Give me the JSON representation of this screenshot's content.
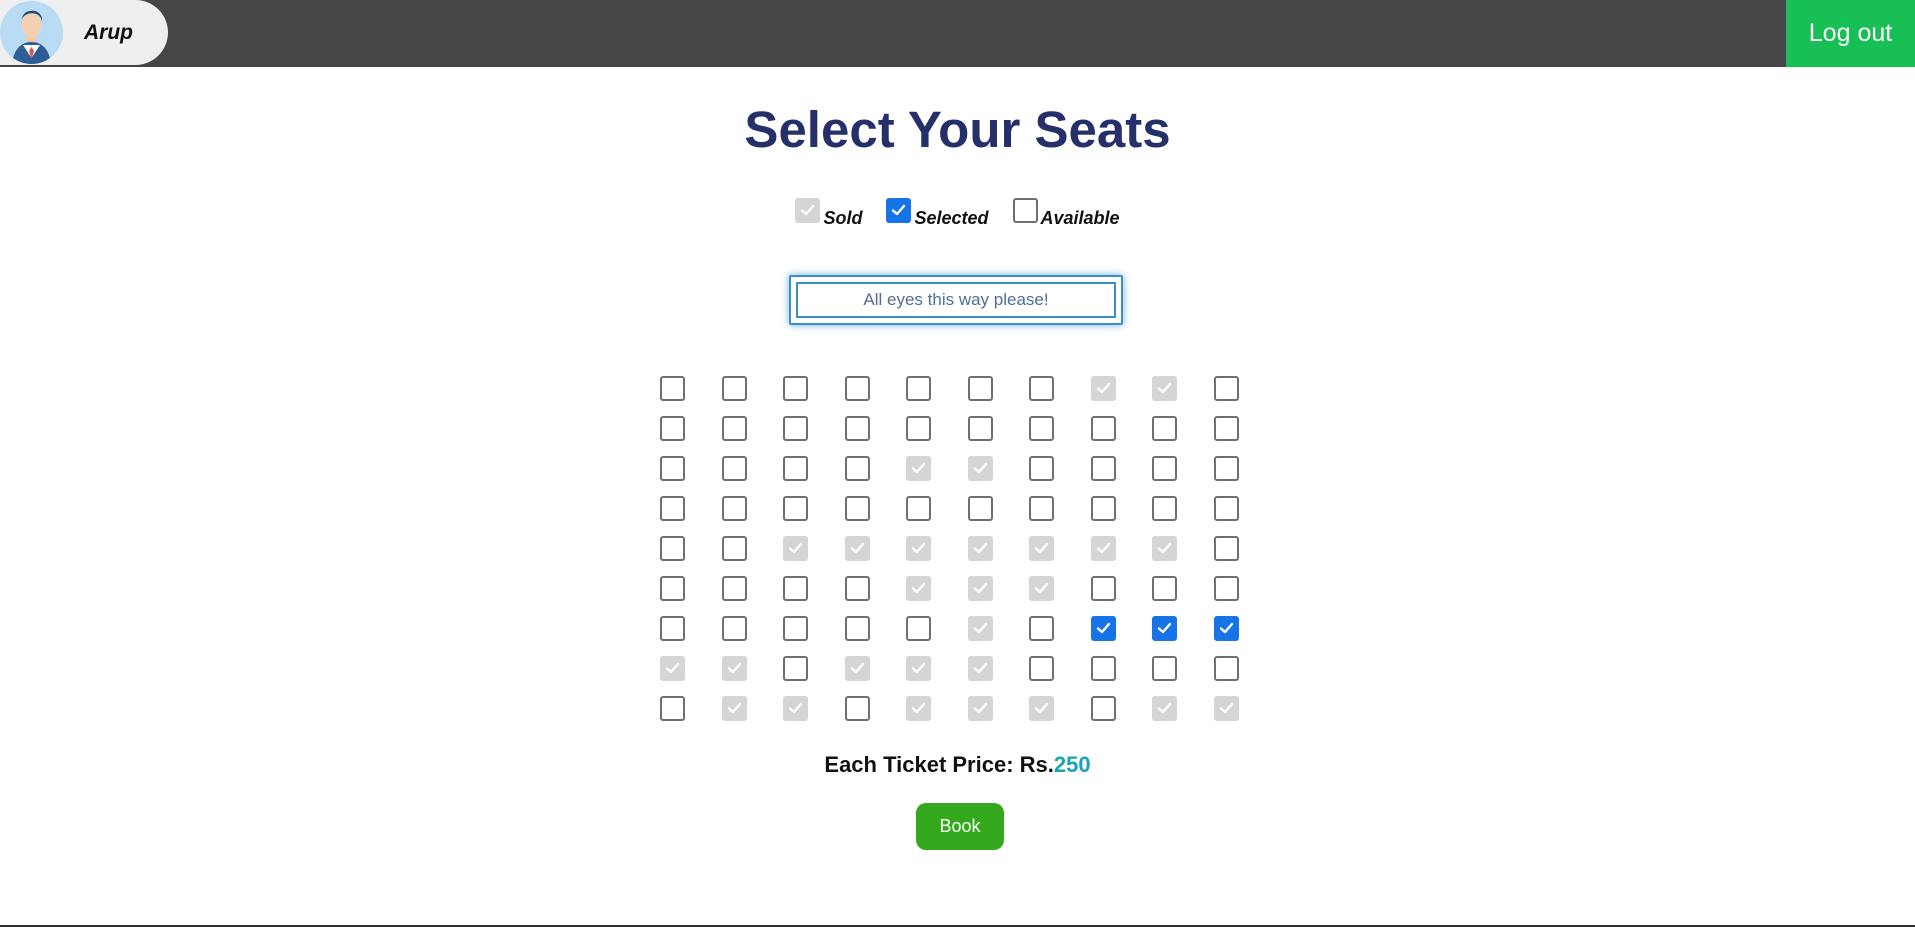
{
  "header": {
    "user_name": "Arup",
    "logout_label": "Log out",
    "avatar_icon": "user-avatar-icon"
  },
  "page": {
    "title": "Select Your Seats"
  },
  "legend": {
    "sold": "Sold",
    "selected": "Selected",
    "available": "Available"
  },
  "screen": {
    "label": "All eyes this way please!"
  },
  "price": {
    "label": "Each Ticket Price: Rs.",
    "value": "250"
  },
  "actions": {
    "book_label": "Book"
  },
  "seats": [
    [
      "available",
      "available",
      "available",
      "available",
      "available",
      "available",
      "available",
      "sold",
      "sold",
      "available"
    ],
    [
      "available",
      "available",
      "available",
      "available",
      "available",
      "available",
      "available",
      "available",
      "available",
      "available"
    ],
    [
      "available",
      "available",
      "available",
      "available",
      "sold",
      "sold",
      "available",
      "available",
      "available",
      "available"
    ],
    [
      "available",
      "available",
      "available",
      "available",
      "available",
      "available",
      "available",
      "available",
      "available",
      "available"
    ],
    [
      "available",
      "available",
      "sold",
      "sold",
      "sold",
      "sold",
      "sold",
      "sold",
      "sold",
      "available"
    ],
    [
      "available",
      "available",
      "available",
      "available",
      "sold",
      "sold",
      "sold",
      "available",
      "available",
      "available"
    ],
    [
      "available",
      "available",
      "available",
      "available",
      "available",
      "sold",
      "available",
      "selected",
      "selected",
      "selected"
    ],
    [
      "sold",
      "sold",
      "available",
      "sold",
      "sold",
      "sold",
      "available",
      "available",
      "available",
      "available"
    ],
    [
      "available",
      "sold",
      "sold",
      "available",
      "sold",
      "sold",
      "sold",
      "available",
      "sold",
      "sold"
    ]
  ],
  "colors": {
    "header_bg": "#454545",
    "logout_bg": "#17bf54",
    "title": "#25306b",
    "selected": "#1673e8",
    "sold": "#d5d5d5",
    "available_border": "#6f6f6f",
    "screen_border": "#3c8fc3",
    "price_value": "#1aa3b2",
    "book_bg": "#35a91d"
  }
}
